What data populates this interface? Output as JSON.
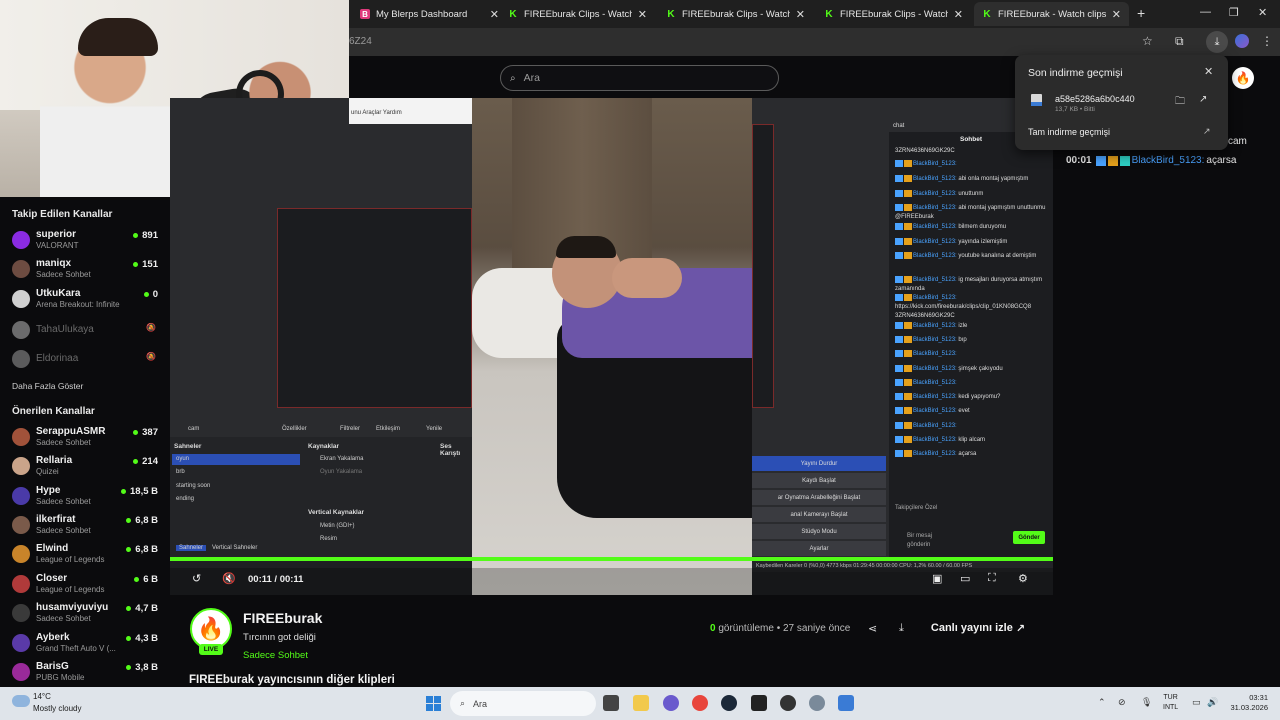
{
  "browser": {
    "tabs": [
      {
        "label": "My Blerps Dashboard",
        "icon": "blerps-icon"
      },
      {
        "label": "FIREEburak Clips - Watch Live o",
        "icon": "kick-icon"
      },
      {
        "label": "FIREEburak Clips - Watch Live o",
        "icon": "kick-icon"
      },
      {
        "label": "FIREEburak Clips - Watch Live o",
        "icon": "kick-icon"
      },
      {
        "label": "FIREEburak - Watch clips on Ki",
        "icon": "kick-icon",
        "active": true
      }
    ],
    "url_fragment": "6Z24"
  },
  "kick": {
    "search_placeholder": "Ara"
  },
  "downloads": {
    "title": "Son indirme geçmişi",
    "file_name": "a58e5286a6b0c440",
    "file_meta": "13,7 KB • Bitti",
    "full_history": "Tam indirme geçmişi"
  },
  "sidebar": {
    "followed_heading": "Takip Edilen Kanallar",
    "followed": [
      {
        "name": "superior",
        "game": "VALORANT",
        "viewers": "891",
        "color": "#8a2be2"
      },
      {
        "name": "maniqx",
        "game": "Sadece Sohbet",
        "viewers": "151",
        "color": "#6d4c41"
      },
      {
        "name": "UtkuKara",
        "game": "Arena Breakout: Infinite",
        "viewers": "0",
        "color": "#d0d0d0"
      }
    ],
    "offline": [
      {
        "name": "TahaUlukaya",
        "color": "#e0e0e0"
      },
      {
        "name": "Eldorinaa",
        "color": "#bdbdbd"
      }
    ],
    "show_more": "Daha Fazla Göster",
    "recommended_heading": "Önerilen Kanallar",
    "recommended": [
      {
        "name": "SerappuASMR",
        "game": "Sadece Sohbet",
        "viewers": "387",
        "color": "#a1523a"
      },
      {
        "name": "Rellaria",
        "game": "Quizei",
        "viewers": "214",
        "color": "#caa48a"
      },
      {
        "name": "Hype",
        "game": "Sadece Sohbet",
        "viewers": "18,5 B",
        "color": "#4a3aa8"
      },
      {
        "name": "ilkerfirat",
        "game": "Sadece Sohbet",
        "viewers": "6,8 B",
        "color": "#7a5a4a"
      },
      {
        "name": "Elwind",
        "game": "League of Legends",
        "viewers": "6,8 B",
        "color": "#c8842a"
      },
      {
        "name": "Closer",
        "game": "League of Legends",
        "viewers": "6 B",
        "color": "#b03a3a"
      },
      {
        "name": "husamviyuviyu",
        "game": "Sadece Sohbet",
        "viewers": "4,7 B",
        "color": "#3a3a3a"
      },
      {
        "name": "Ayberk",
        "game": "Grand Theft Auto V (...",
        "viewers": "4,3 B",
        "color": "#5a3aa8"
      },
      {
        "name": "BarisG",
        "game": "PUBG Mobile",
        "viewers": "3,8 B",
        "color": "#9a2a9a"
      }
    ]
  },
  "video": {
    "time": "00:11 / 00:11",
    "progress": 1.0,
    "obs": {
      "menu": "unu  Araçlar  Yardım",
      "scenes_title": "Sahneler",
      "scenes": [
        "oyun",
        "brb",
        "starting soon",
        "ending"
      ],
      "sources_title": "Kaynaklar",
      "sources": [
        "Ekran Yakalama",
        "Oyun Yakalama"
      ],
      "vertical_sources_title": "Vertical Kaynaklar",
      "vertical_sources": [
        "Metin (GDI+)",
        "Resim"
      ],
      "mixer_title": "Ses Karıştı",
      "cam_label": "cam",
      "props": "Özellikler",
      "filters": "Filtreler",
      "interact": "Etkileşim",
      "refresh": "Yenile",
      "tab_scenes": "Sahneler",
      "tab_vertical": "Vertical Sahneler",
      "controls": [
        "Yayını Durdur",
        "Kaydı Başlat",
        "ar Oynatma Arabelleğini Başlat",
        "anal Kamerayı Başlat",
        "Stüdyo Modu",
        "Ayarlar"
      ],
      "status": "Kaybedilen Kareler 0 (%0,0)   4773 kbps   01:29:45   00:00:00   CPU: 1,2%   60.00 / 60.00 FPS",
      "chat_top": "chat",
      "chat_tab": "Sohbet",
      "chat_link1": "3ZRN4636N69GK29C",
      "chat_messages": [
        {
          "user": "BlackBird_5123:",
          "text": ""
        },
        {
          "user": "BlackBird_5123:",
          "text": "abi onla montaj yapmıştım"
        },
        {
          "user": "BlackBird_5123:",
          "text": "unuttunm"
        },
        {
          "user": "BlackBird_5123:",
          "text": "abi montaj yapmıştım unuttunmu @FIREEburak"
        },
        {
          "user": "BlackBird_5123:",
          "text": "bilmem duruyomu"
        },
        {
          "user": "BlackBird_5123:",
          "text": "yayında izlemiştim"
        },
        {
          "user": "BlackBird_5123:",
          "text": "youtube kanalına at demiştim"
        },
        {
          "user": "BlackBird_5123:",
          "text": "ig mesajları duruyorsa atmıştım zamanında"
        },
        {
          "user": "BlackBird_5123:",
          "text": "https://kick.com/fireeburak/clips/clip_01KN08GCQ8 3ZRN4636N69GK29C"
        },
        {
          "user": "BlackBird_5123:",
          "text": "izle"
        },
        {
          "user": "BlackBird_5123:",
          "text": "bıp"
        },
        {
          "user": "BlackBird_5123:",
          "text": ""
        },
        {
          "user": "BlackBird_5123:",
          "text": "şimşek çakıyodu"
        },
        {
          "user": "BlackBird_5123:",
          "text": ""
        },
        {
          "user": "BlackBird_5123:",
          "text": "kedi yapıyomu?"
        },
        {
          "user": "BlackBird_5123:",
          "text": "evet"
        },
        {
          "user": "BlackBird_5123:",
          "text": ""
        },
        {
          "user": "BlackBird_5123:",
          "text": "klip alcam"
        },
        {
          "user": "BlackBird_5123:",
          "text": "açarsa"
        }
      ],
      "followers_only": "Takipçilere Özel",
      "send_message": "Bir mesaj gönderin",
      "send": "Gönder"
    }
  },
  "right_chat": {
    "fragment": "cam",
    "time": "00:01",
    "user": "BlackBird_5123:",
    "text": "açarsa"
  },
  "channel": {
    "name": "FIREEburak",
    "title": "Tırcının got deliği",
    "category": "Sadece Sohbet",
    "live": "LIVE",
    "views_count": "0",
    "views_label": "görüntüleme",
    "ago": "• 27 saniye önce",
    "watch_live": "Canlı yayını izle",
    "more_clips": "FIREEburak yayıncısının diğer klipleri"
  },
  "taskbar": {
    "temp": "14°C",
    "weather": "Mostly cloudy",
    "search": "Ara",
    "lang1": "TUR",
    "lang2": "INTL",
    "time": "03:31",
    "date": "31.03.2026"
  },
  "colors": {
    "accent": "#53fc18",
    "badge_blue": "#4aa3ff",
    "badge_gold": "#e5a11c"
  }
}
